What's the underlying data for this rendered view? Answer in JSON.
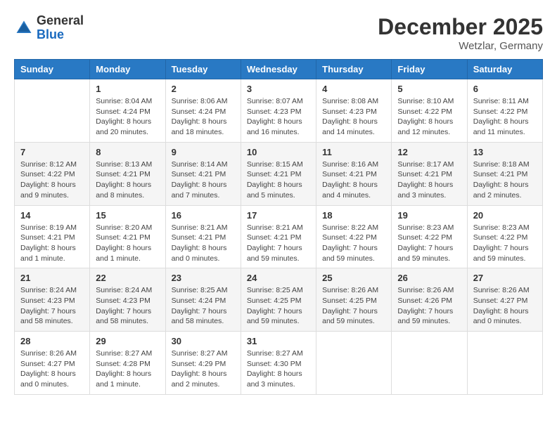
{
  "header": {
    "logo_general": "General",
    "logo_blue": "Blue",
    "month_title": "December 2025",
    "location": "Wetzlar, Germany"
  },
  "weekdays": [
    "Sunday",
    "Monday",
    "Tuesday",
    "Wednesday",
    "Thursday",
    "Friday",
    "Saturday"
  ],
  "weeks": [
    [
      {
        "day": "",
        "info": ""
      },
      {
        "day": "1",
        "info": "Sunrise: 8:04 AM\nSunset: 4:24 PM\nDaylight: 8 hours\nand 20 minutes."
      },
      {
        "day": "2",
        "info": "Sunrise: 8:06 AM\nSunset: 4:24 PM\nDaylight: 8 hours\nand 18 minutes."
      },
      {
        "day": "3",
        "info": "Sunrise: 8:07 AM\nSunset: 4:23 PM\nDaylight: 8 hours\nand 16 minutes."
      },
      {
        "day": "4",
        "info": "Sunrise: 8:08 AM\nSunset: 4:23 PM\nDaylight: 8 hours\nand 14 minutes."
      },
      {
        "day": "5",
        "info": "Sunrise: 8:10 AM\nSunset: 4:22 PM\nDaylight: 8 hours\nand 12 minutes."
      },
      {
        "day": "6",
        "info": "Sunrise: 8:11 AM\nSunset: 4:22 PM\nDaylight: 8 hours\nand 11 minutes."
      }
    ],
    [
      {
        "day": "7",
        "info": "Sunrise: 8:12 AM\nSunset: 4:22 PM\nDaylight: 8 hours\nand 9 minutes."
      },
      {
        "day": "8",
        "info": "Sunrise: 8:13 AM\nSunset: 4:21 PM\nDaylight: 8 hours\nand 8 minutes."
      },
      {
        "day": "9",
        "info": "Sunrise: 8:14 AM\nSunset: 4:21 PM\nDaylight: 8 hours\nand 7 minutes."
      },
      {
        "day": "10",
        "info": "Sunrise: 8:15 AM\nSunset: 4:21 PM\nDaylight: 8 hours\nand 5 minutes."
      },
      {
        "day": "11",
        "info": "Sunrise: 8:16 AM\nSunset: 4:21 PM\nDaylight: 8 hours\nand 4 minutes."
      },
      {
        "day": "12",
        "info": "Sunrise: 8:17 AM\nSunset: 4:21 PM\nDaylight: 8 hours\nand 3 minutes."
      },
      {
        "day": "13",
        "info": "Sunrise: 8:18 AM\nSunset: 4:21 PM\nDaylight: 8 hours\nand 2 minutes."
      }
    ],
    [
      {
        "day": "14",
        "info": "Sunrise: 8:19 AM\nSunset: 4:21 PM\nDaylight: 8 hours\nand 1 minute."
      },
      {
        "day": "15",
        "info": "Sunrise: 8:20 AM\nSunset: 4:21 PM\nDaylight: 8 hours\nand 1 minute."
      },
      {
        "day": "16",
        "info": "Sunrise: 8:21 AM\nSunset: 4:21 PM\nDaylight: 8 hours\nand 0 minutes."
      },
      {
        "day": "17",
        "info": "Sunrise: 8:21 AM\nSunset: 4:21 PM\nDaylight: 7 hours\nand 59 minutes."
      },
      {
        "day": "18",
        "info": "Sunrise: 8:22 AM\nSunset: 4:22 PM\nDaylight: 7 hours\nand 59 minutes."
      },
      {
        "day": "19",
        "info": "Sunrise: 8:23 AM\nSunset: 4:22 PM\nDaylight: 7 hours\nand 59 minutes."
      },
      {
        "day": "20",
        "info": "Sunrise: 8:23 AM\nSunset: 4:22 PM\nDaylight: 7 hours\nand 59 minutes."
      }
    ],
    [
      {
        "day": "21",
        "info": "Sunrise: 8:24 AM\nSunset: 4:23 PM\nDaylight: 7 hours\nand 58 minutes."
      },
      {
        "day": "22",
        "info": "Sunrise: 8:24 AM\nSunset: 4:23 PM\nDaylight: 7 hours\nand 58 minutes."
      },
      {
        "day": "23",
        "info": "Sunrise: 8:25 AM\nSunset: 4:24 PM\nDaylight: 7 hours\nand 58 minutes."
      },
      {
        "day": "24",
        "info": "Sunrise: 8:25 AM\nSunset: 4:25 PM\nDaylight: 7 hours\nand 59 minutes."
      },
      {
        "day": "25",
        "info": "Sunrise: 8:26 AM\nSunset: 4:25 PM\nDaylight: 7 hours\nand 59 minutes."
      },
      {
        "day": "26",
        "info": "Sunrise: 8:26 AM\nSunset: 4:26 PM\nDaylight: 7 hours\nand 59 minutes."
      },
      {
        "day": "27",
        "info": "Sunrise: 8:26 AM\nSunset: 4:27 PM\nDaylight: 8 hours\nand 0 minutes."
      }
    ],
    [
      {
        "day": "28",
        "info": "Sunrise: 8:26 AM\nSunset: 4:27 PM\nDaylight: 8 hours\nand 0 minutes."
      },
      {
        "day": "29",
        "info": "Sunrise: 8:27 AM\nSunset: 4:28 PM\nDaylight: 8 hours\nand 1 minute."
      },
      {
        "day": "30",
        "info": "Sunrise: 8:27 AM\nSunset: 4:29 PM\nDaylight: 8 hours\nand 2 minutes."
      },
      {
        "day": "31",
        "info": "Sunrise: 8:27 AM\nSunset: 4:30 PM\nDaylight: 8 hours\nand 3 minutes."
      },
      {
        "day": "",
        "info": ""
      },
      {
        "day": "",
        "info": ""
      },
      {
        "day": "",
        "info": ""
      }
    ]
  ]
}
